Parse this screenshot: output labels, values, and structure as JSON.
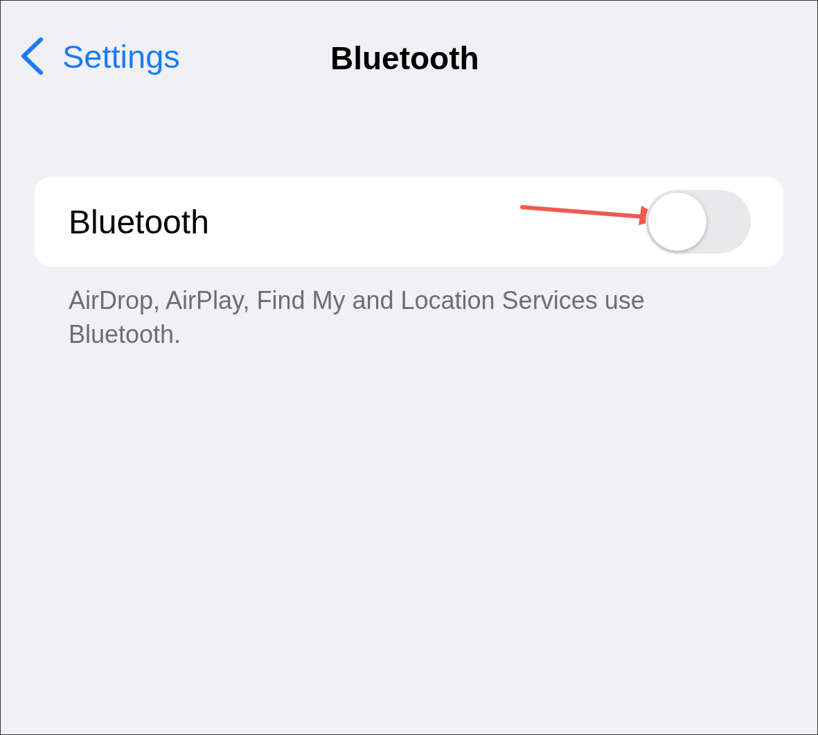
{
  "nav_bar": {
    "back_label": "Settings",
    "title": "Bluetooth"
  },
  "bluetooth": {
    "label": "Bluetooth",
    "on": false
  },
  "footer": "AirDrop, AirPlay, Find My and Location Services use Bluetooth."
}
